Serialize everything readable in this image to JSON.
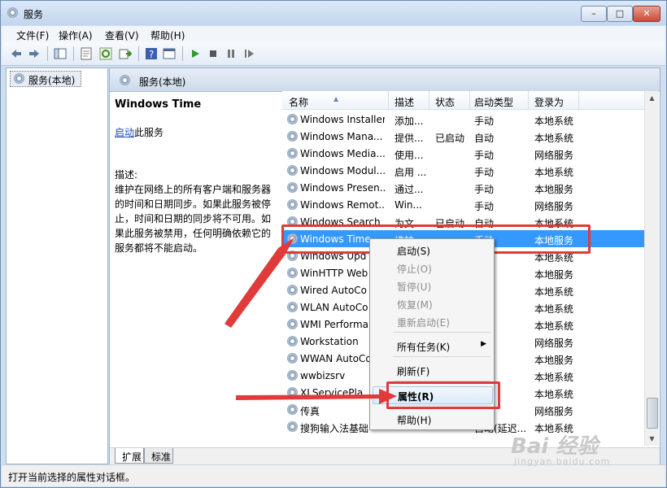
{
  "window": {
    "title": "服务",
    "min_label": "–",
    "max_label": "□",
    "close_label": "✕"
  },
  "menu": {
    "items": [
      "文件(F)",
      "操作(A)",
      "查看(V)",
      "帮助(H)"
    ]
  },
  "toolbar": {
    "icons": [
      "back-icon",
      "forward-icon",
      "show-hide-tree-icon",
      "properties-icon",
      "refresh-icon",
      "export-icon",
      "help-icon",
      "console-icon",
      "start-service-icon",
      "stop-service-icon",
      "pause-service-icon",
      "resume-service-icon"
    ]
  },
  "left_tree": {
    "item": "服务(本地)"
  },
  "right_header": {
    "title": "服务(本地)"
  },
  "detail": {
    "name": "Windows Time",
    "action_link": "启动",
    "action_suffix": "此服务",
    "desc_label": "描述:",
    "desc_text": "维护在网络上的所有客户端和服务器的时间和日期同步。如果此服务被停止，时间和日期的同步将不可用。如果此服务被禁用，任何明确依赖它的服务都将不能启动。"
  },
  "columns": [
    "名称",
    "描述",
    "状态",
    "启动类型",
    "登录为"
  ],
  "rows": [
    {
      "name": "Windows Installer",
      "desc": "添加...",
      "status": "",
      "start": "手动",
      "logon": "本地系统"
    },
    {
      "name": "Windows Mana...",
      "desc": "提供...",
      "status": "已启动",
      "start": "自动",
      "logon": "本地系统"
    },
    {
      "name": "Windows Media...",
      "desc": "使用...",
      "status": "",
      "start": "手动",
      "logon": "网络服务"
    },
    {
      "name": "Windows Modul...",
      "desc": "启用 ...",
      "status": "",
      "start": "手动",
      "logon": "本地系统"
    },
    {
      "name": "Windows Presen...",
      "desc": "通过...",
      "status": "",
      "start": "手动",
      "logon": "本地服务"
    },
    {
      "name": "Windows Remot...",
      "desc": "Win...",
      "status": "",
      "start": "手动",
      "logon": "网络服务"
    },
    {
      "name": "Windows Search",
      "desc": "为文...",
      "status": "已启动",
      "start": "自动",
      "logon": "本地系统"
    },
    {
      "name": "Windows Time",
      "desc": "维护...",
      "status": "",
      "start": "手动",
      "logon": "本地服务"
    },
    {
      "name": "Windows Upd",
      "desc": "",
      "status": "",
      "start": "",
      "logon": "本地系统"
    },
    {
      "name": "WinHTTP Web",
      "desc": "",
      "status": "",
      "start": "",
      "logon": "本地服务"
    },
    {
      "name": "Wired AutoCo",
      "desc": "",
      "status": "",
      "start": "",
      "logon": "本地系统"
    },
    {
      "name": "WLAN AutoCo",
      "desc": "",
      "status": "",
      "start": "",
      "logon": "本地系统"
    },
    {
      "name": "WMI Performa",
      "desc": "",
      "status": "",
      "start": "",
      "logon": "本地系统"
    },
    {
      "name": "Workstation",
      "desc": "",
      "status": "",
      "start": "",
      "logon": "网络服务"
    },
    {
      "name": "WWAN AutoCo",
      "desc": "",
      "status": "",
      "start": "",
      "logon": "本地服务"
    },
    {
      "name": "wwbizsrv",
      "desc": "",
      "status": "",
      "start": "",
      "logon": "本地系统"
    },
    {
      "name": "XLServicePla",
      "desc": "",
      "status": "",
      "start": "",
      "logon": "本地系统"
    },
    {
      "name": "传真",
      "desc": "",
      "status": "",
      "start": "",
      "logon": "网络服务"
    },
    {
      "name": "搜狗输入法基础",
      "desc": "",
      "status": "",
      "start": "自动(延迟...",
      "logon": "本地系统"
    }
  ],
  "selected_row": "Windows Time",
  "context_menu": {
    "items": [
      {
        "label": "启动(S)",
        "enabled": true
      },
      {
        "label": "停止(O)",
        "enabled": false
      },
      {
        "label": "暂停(U)",
        "enabled": false
      },
      {
        "label": "恢复(M)",
        "enabled": false
      },
      {
        "label": "重新启动(E)",
        "enabled": false
      },
      {
        "label": "所有任务(K)",
        "enabled": true,
        "submenu": true
      },
      {
        "label": "刷新(F)",
        "enabled": true
      },
      {
        "label": "属性(R)",
        "enabled": true,
        "highlighted": true
      },
      {
        "label": "帮助(H)",
        "enabled": true
      }
    ],
    "submenu_arrow": "▶"
  },
  "tabs": [
    "扩展",
    "标准"
  ],
  "statusbar": {
    "text": "打开当前选择的属性对话框。"
  },
  "watermark": {
    "line1": "Bai 经验",
    "line2": "jingyan.baidu.com"
  },
  "colors": {
    "selection": "#3399ff",
    "annotation_red": "#e03a3a",
    "link": "#1c4cbf"
  }
}
